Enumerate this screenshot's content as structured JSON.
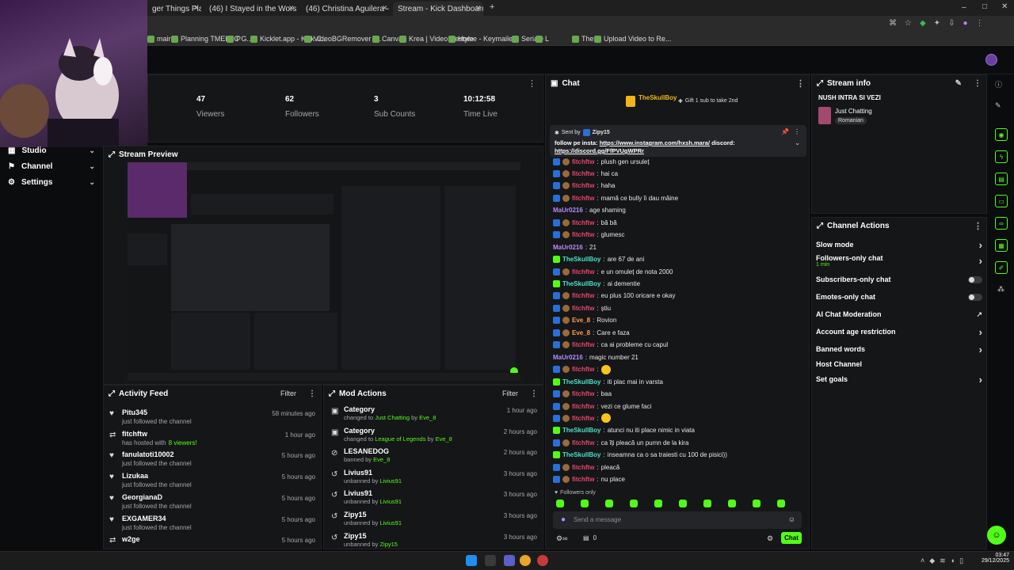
{
  "browser": {
    "tabs": [
      {
        "label": "ger Things Playlist |",
        "active": false,
        "color": "#e53935"
      },
      {
        "label": "(46) I Stayed in the Worst Room",
        "active": false,
        "color": "#e53935"
      },
      {
        "label": "(46) Christina Aguilera - Genie",
        "active": false,
        "color": "#e53935"
      },
      {
        "label": "Stream - Kick Dashboard",
        "active": true,
        "color": "#53fc18"
      }
    ],
    "new_tab": "+",
    "bookmarks": [
      "maire",
      "Planning TMELEC G...",
      "P",
      "Kicklet.app - Kick C...",
      "VideoBGRemover -...",
      "Canva",
      "Krea | Video Restyle",
      "Home - Keymailer",
      "Seriale",
      "L",
      "The",
      "Upload Video to Re..."
    ]
  },
  "stats": [
    {
      "value": "47",
      "label": "Viewers"
    },
    {
      "value": "62",
      "label": "Followers"
    },
    {
      "value": "3",
      "label": "Sub Counts"
    },
    {
      "value": "10:12:58",
      "label": "Time Live"
    }
  ],
  "sidebar": {
    "items": [
      {
        "label": "Studio"
      },
      {
        "label": "Channel"
      },
      {
        "label": "Settings"
      }
    ]
  },
  "stream_preview": {
    "title": "Stream Preview"
  },
  "activity_feed": {
    "title": "Activity Feed",
    "filter": "Filter",
    "items": [
      {
        "name": "Pitu345",
        "sub": "just followed the channel",
        "time": "58 minutes ago",
        "icon": "heart-icon"
      },
      {
        "name": "fitchftw",
        "sub": "has hosted with",
        "sub_count": "8 viewers!",
        "time": "1 hour ago",
        "icon": "host-icon"
      },
      {
        "name": "fanulatoti10002",
        "sub": "just followed the channel",
        "time": "5 hours ago",
        "icon": "heart-icon"
      },
      {
        "name": "Lizukaa",
        "sub": "just followed the channel",
        "time": "5 hours ago",
        "icon": "heart-icon"
      },
      {
        "name": "GeorgianaD",
        "sub": "just followed the channel",
        "time": "5 hours ago",
        "icon": "heart-icon"
      },
      {
        "name": "EXGAMER34",
        "sub": "just followed the channel",
        "time": "5 hours ago",
        "icon": "heart-icon"
      },
      {
        "name": "w2ge",
        "sub": "",
        "time": "5 hours ago",
        "icon": "host-icon"
      }
    ]
  },
  "mod_actions": {
    "title": "Mod Actions",
    "filter": "Filter",
    "items": [
      {
        "name": "Category",
        "pre": "changed to",
        "val": "Just Chatting",
        "mid": "by",
        "by": "Eve_8",
        "time": "1 hour ago",
        "icon": "category-icon"
      },
      {
        "name": "Category",
        "pre": "changed to",
        "val": "League of Legends",
        "mid": "by",
        "by": "Eve_8",
        "time": "2 hours ago",
        "icon": "category-icon"
      },
      {
        "name": "LESANEDOG",
        "pre": "banned by",
        "val": "",
        "mid": "",
        "by": "Eve_8",
        "time": "2 hours ago",
        "icon": "ban-icon"
      },
      {
        "name": "Livius91",
        "pre": "unbanned by",
        "val": "",
        "mid": "",
        "by": "Livius91",
        "time": "3 hours ago",
        "icon": "undo-icon"
      },
      {
        "name": "Livius91",
        "pre": "unbanned by",
        "val": "",
        "mid": "",
        "by": "Livius91",
        "time": "3 hours ago",
        "icon": "undo-icon"
      },
      {
        "name": "Zipy15",
        "pre": "unbanned by",
        "val": "",
        "mid": "",
        "by": "Livius91",
        "time": "3 hours ago",
        "icon": "undo-icon"
      },
      {
        "name": "Zipy15",
        "pre": "unbanned by",
        "val": "",
        "mid": "",
        "by": "Zipy15",
        "time": "3 hours ago",
        "icon": "undo-icon"
      }
    ]
  },
  "chat": {
    "title": "Chat",
    "top_gifter": "TheSkullBoy",
    "gift_text": "Gift 1 sub to take 2nd",
    "pinned": {
      "sent_by_label": "Sent by",
      "sent_by": "Zipy15",
      "text_pre": "follow pe insta:",
      "link1": "https://www.instagram.com/hxsh.mara/",
      "text_mid": "discord:",
      "link2": "https://discord.gg/FfPVUgWPRr"
    },
    "messages": [
      {
        "user": "fitchftw",
        "color": "pink",
        "text": "plush gen ursuleț",
        "badges": [
          "blue",
          "brown"
        ]
      },
      {
        "user": "fitchftw",
        "color": "pink",
        "text": "hai ca",
        "badges": [
          "blue",
          "brown"
        ]
      },
      {
        "user": "fitchftw",
        "color": "pink",
        "text": "haha",
        "badges": [
          "blue",
          "brown"
        ]
      },
      {
        "user": "fitchftw",
        "color": "pink",
        "text": "mamă ce bully îi dau mâine",
        "badges": [
          "blue",
          "brown"
        ]
      },
      {
        "user": "MaUr0216",
        "color": "purple",
        "text": "age shaming",
        "badges": []
      },
      {
        "user": "fitchftw",
        "color": "pink",
        "text": "bă bă",
        "badges": [
          "blue",
          "brown"
        ]
      },
      {
        "user": "fitchftw",
        "color": "pink",
        "text": "glumesc",
        "badges": [
          "blue",
          "brown"
        ]
      },
      {
        "user": "MaUr0216",
        "color": "purple",
        "text": "21",
        "badges": []
      },
      {
        "user": "TheSkullBoy",
        "color": "teal",
        "text": "are 67 de ani",
        "badges": [
          "kick"
        ]
      },
      {
        "user": "fitchftw",
        "color": "pink",
        "text": "e un omuleț de nota 2000",
        "badges": [
          "blue",
          "brown"
        ]
      },
      {
        "user": "TheSkullBoy",
        "color": "teal",
        "text": "ai dementie",
        "badges": [
          "kick"
        ]
      },
      {
        "user": "fitchftw",
        "color": "pink",
        "text": "eu plus 100 oricare e okay",
        "badges": [
          "blue",
          "brown"
        ]
      },
      {
        "user": "fitchftw",
        "color": "pink",
        "text": "știu",
        "badges": [
          "blue",
          "brown"
        ]
      },
      {
        "user": "Eve_8",
        "color": "orange",
        "text": "Rovion",
        "badges": [
          "blue",
          "brown"
        ]
      },
      {
        "user": "Eve_8",
        "color": "orange",
        "text": "Care e faza",
        "badges": [
          "blue",
          "brown"
        ]
      },
      {
        "user": "fitchftw",
        "color": "pink",
        "text": "ca ai probleme cu capul",
        "badges": [
          "blue",
          "brown"
        ]
      },
      {
        "user": "MaUr0216",
        "color": "purple",
        "text": "magic number 21",
        "badges": []
      },
      {
        "user": "fitchftw",
        "color": "pink",
        "text": "",
        "emoji": true,
        "badges": [
          "blue",
          "brown"
        ]
      },
      {
        "user": "TheSkullBoy",
        "color": "teal",
        "text": "iti plac mai in varsta",
        "badges": [
          "kick"
        ]
      },
      {
        "user": "fitchftw",
        "color": "pink",
        "text": "baa",
        "badges": [
          "blue",
          "brown"
        ]
      },
      {
        "user": "fitchftw",
        "color": "pink",
        "text": "vezi ce glume faci",
        "badges": [
          "blue",
          "brown"
        ]
      },
      {
        "user": "fitchftw",
        "color": "pink",
        "text": "",
        "emoji": true,
        "badges": [
          "blue",
          "brown"
        ]
      },
      {
        "user": "TheSkullBoy",
        "color": "teal",
        "text": "atunci nu iti place nimic in viata",
        "badges": [
          "kick"
        ]
      },
      {
        "user": "fitchftw",
        "color": "pink",
        "text": "ca îți pleacă un pumn de la kira",
        "badges": [
          "blue",
          "brown"
        ]
      },
      {
        "user": "TheSkullBoy",
        "color": "teal",
        "text": "inseamna ca o sa traiesti cu 100 de pisici))",
        "badges": [
          "kick"
        ]
      },
      {
        "user": "fitchftw",
        "color": "pink",
        "text": "pleacă",
        "badges": [
          "blue",
          "brown"
        ]
      },
      {
        "user": "fitchftw",
        "color": "pink",
        "text": "nu place",
        "badges": [
          "blue",
          "brown"
        ]
      }
    ],
    "followers_only": "Followers only",
    "input_placeholder": "Send a message",
    "viewer_count_icon": "0",
    "send_label": "Chat"
  },
  "stream_info": {
    "title": "Stream info",
    "stream_title": "NUSH INTRA SI VEZI",
    "category": "Just Chatting",
    "tag": "Romanian"
  },
  "channel_actions": {
    "title": "Channel Actions",
    "items": [
      {
        "label": "Slow mode",
        "control": "chevron"
      },
      {
        "label": "Followers-only chat",
        "sub": "1 min",
        "control": "chevron"
      },
      {
        "label": "Subscribers-only chat",
        "control": "toggle"
      },
      {
        "label": "Emotes-only chat",
        "control": "toggle"
      },
      {
        "label": "AI Chat Moderation",
        "control": "external"
      },
      {
        "label": "Account age restriction",
        "control": "chevron"
      },
      {
        "label": "Banned words",
        "control": "chevron"
      },
      {
        "label": "Host Channel",
        "control": "none"
      },
      {
        "label": "Set goals",
        "control": "chevron"
      }
    ]
  },
  "taskbar": {
    "time": "03:47",
    "date": "29/12/2025"
  },
  "colors": {
    "kick_green": "#53fc18",
    "panel_bg": "#151618",
    "page_bg": "#0b0c0d"
  }
}
